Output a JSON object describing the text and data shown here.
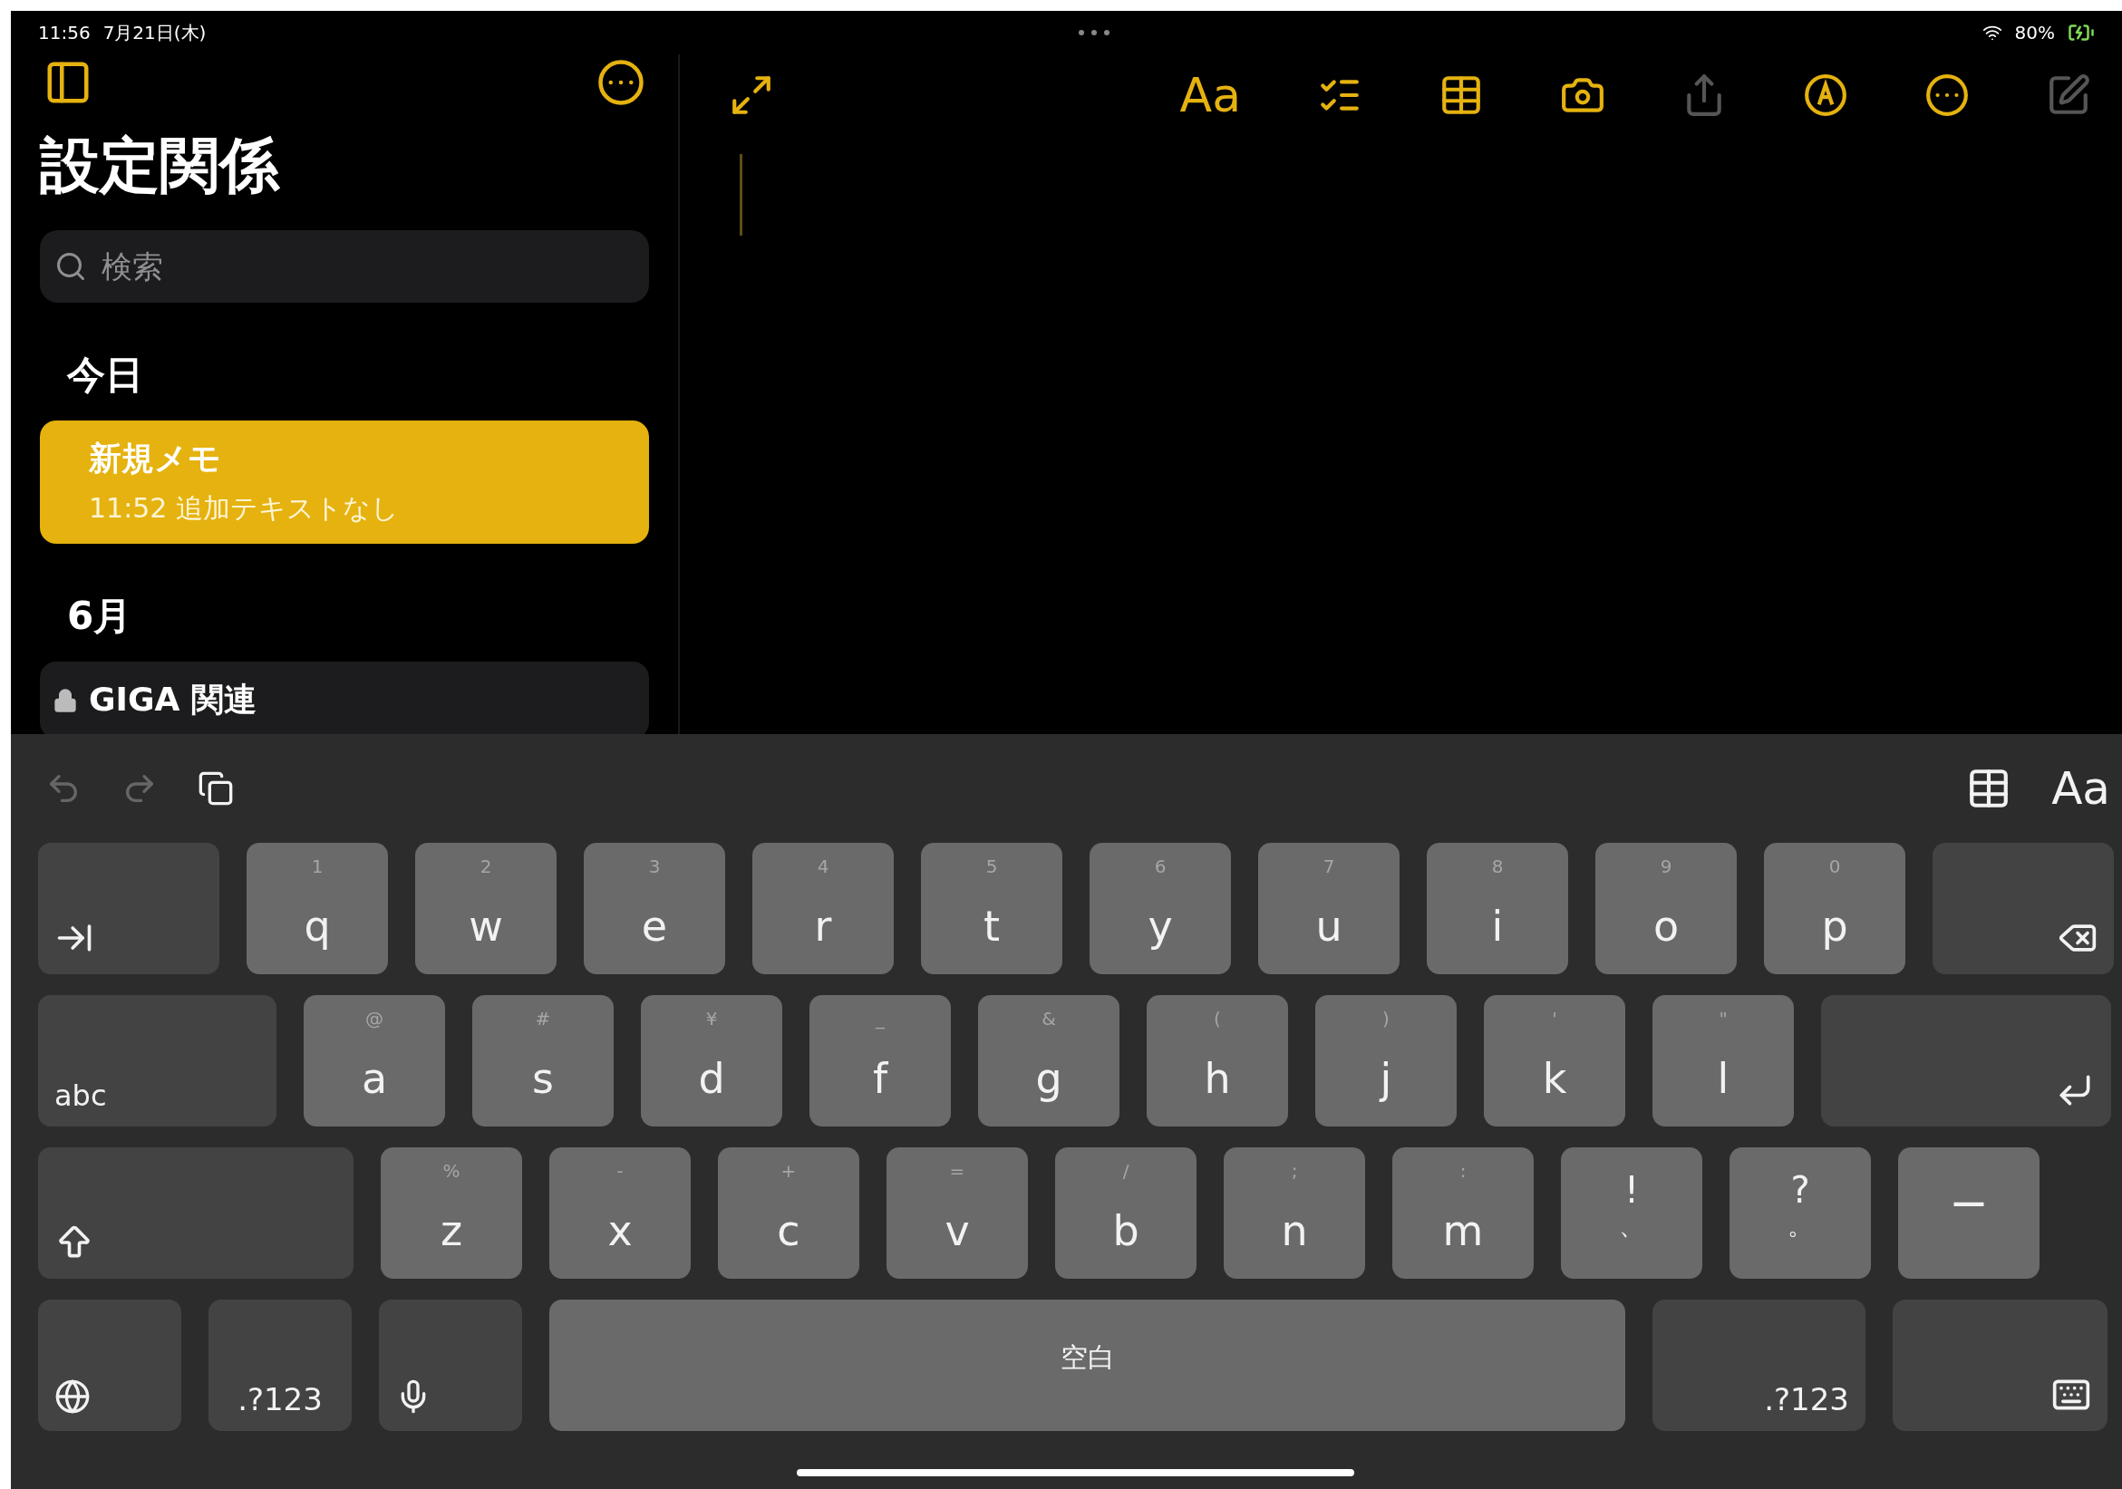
{
  "status_bar": {
    "time": "11:56",
    "date": "7月21日(木)",
    "battery": "80%"
  },
  "sidebar": {
    "title": "設定関係",
    "search": {
      "placeholder": "検索"
    },
    "sections": [
      {
        "header": "今日",
        "notes": [
          {
            "title": "新規メモ",
            "time": "11:52",
            "preview": "追加テキストなし",
            "selected": true,
            "locked": false
          }
        ]
      },
      {
        "header": "6月",
        "notes": [
          {
            "title": "GIGA 関連",
            "selected": false,
            "locked": true
          }
        ]
      }
    ]
  },
  "toolbar": [
    {
      "kind": "expand",
      "disabled": false
    },
    {
      "kind": "format",
      "label": "Aa",
      "disabled": false
    },
    {
      "kind": "checklist",
      "disabled": false
    },
    {
      "kind": "table",
      "disabled": false
    },
    {
      "kind": "camera",
      "disabled": false
    },
    {
      "kind": "share",
      "disabled": true
    },
    {
      "kind": "markup",
      "disabled": false
    },
    {
      "kind": "more",
      "disabled": false
    },
    {
      "kind": "compose",
      "disabled": true
    }
  ],
  "keyboard": {
    "shortcuts_left": [
      {
        "kind": "undo",
        "disabled": true
      },
      {
        "kind": "redo",
        "disabled": true
      },
      {
        "kind": "paste",
        "disabled": false
      }
    ],
    "shortcuts_right": [
      {
        "kind": "table",
        "disabled": false
      },
      {
        "kind": "format",
        "label": "Aa",
        "disabled": false
      }
    ],
    "rows": [
      [
        {
          "kind": "tab"
        },
        {
          "kind": "letter",
          "label": "q",
          "hint": "1"
        },
        {
          "kind": "letter",
          "label": "w",
          "hint": "2"
        },
        {
          "kind": "letter",
          "label": "e",
          "hint": "3"
        },
        {
          "kind": "letter",
          "label": "r",
          "hint": "4"
        },
        {
          "kind": "letter",
          "label": "t",
          "hint": "5"
        },
        {
          "kind": "letter",
          "label": "y",
          "hint": "6"
        },
        {
          "kind": "letter",
          "label": "u",
          "hint": "7"
        },
        {
          "kind": "letter",
          "label": "i",
          "hint": "8"
        },
        {
          "kind": "letter",
          "label": "o",
          "hint": "9"
        },
        {
          "kind": "letter",
          "label": "p",
          "hint": "0"
        },
        {
          "kind": "delete"
        }
      ],
      [
        {
          "kind": "abc",
          "label": "abc"
        },
        {
          "kind": "letter",
          "label": "a",
          "hint": "@"
        },
        {
          "kind": "letter",
          "label": "s",
          "hint": "#"
        },
        {
          "kind": "letter",
          "label": "d",
          "hint": "¥"
        },
        {
          "kind": "letter",
          "label": "f",
          "hint": "_"
        },
        {
          "kind": "letter",
          "label": "g",
          "hint": "&"
        },
        {
          "kind": "letter",
          "label": "h",
          "hint": "("
        },
        {
          "kind": "letter",
          "label": "j",
          "hint": ")"
        },
        {
          "kind": "letter",
          "label": "k",
          "hint": "'"
        },
        {
          "kind": "letter",
          "label": "l",
          "hint": "\""
        },
        {
          "kind": "return"
        }
      ],
      [
        {
          "kind": "shift"
        },
        {
          "kind": "letter",
          "label": "z",
          "hint": "%"
        },
        {
          "kind": "letter",
          "label": "x",
          "hint": "-"
        },
        {
          "kind": "letter",
          "label": "c",
          "hint": "+"
        },
        {
          "kind": "letter",
          "label": "v",
          "hint": "="
        },
        {
          "kind": "letter",
          "label": "b",
          "hint": "/"
        },
        {
          "kind": "letter",
          "label": "n",
          "hint": ";"
        },
        {
          "kind": "letter",
          "label": "m",
          "hint": ":"
        },
        {
          "kind": "punct",
          "label": "!",
          "hint": "、"
        },
        {
          "kind": "punct",
          "label": "?",
          "hint": "。"
        },
        {
          "kind": "dash",
          "label": "ー"
        }
      ],
      [
        {
          "kind": "globe"
        },
        {
          "kind": "numbers",
          "label": ".?123"
        },
        {
          "kind": "mic"
        },
        {
          "kind": "space",
          "label": "空白"
        },
        {
          "kind": "numbers",
          "label": ".?123"
        },
        {
          "kind": "hide"
        }
      ]
    ]
  }
}
